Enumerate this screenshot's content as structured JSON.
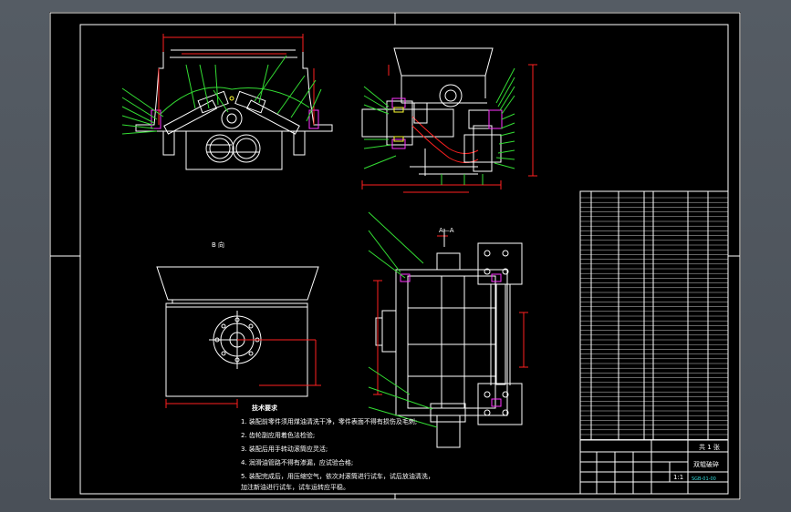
{
  "drawing": {
    "view_label": "B 向",
    "section_label": "A—A",
    "notes_title": "技术要求",
    "notes": [
      "1. 装配前零件须用煤油清洗干净，零件表面不得有损伤及毛刺;",
      "2. 齿轮副应用着色法检验;",
      "3. 装配后用手转动滚筒应灵活;",
      "4. 润滑油管路不得有渗漏，应试验合格;",
      "5. 装配完成后，用压缩空气，依次对滚筒进行试车，试后放油清洗，",
      "   加注新油进行试车，试车运转应平稳。"
    ],
    "title_block": {
      "name": "双辊破碎",
      "drawing_no": "SGB-01-00",
      "scale": "1:1",
      "sheet": "共 1 张"
    }
  },
  "colors": {
    "background": "#000000",
    "outline": "#ffffff",
    "dimension": "#ff2020",
    "leader": "#33dd33",
    "hidden": "#ff33ff",
    "viewport": "#555c64"
  }
}
